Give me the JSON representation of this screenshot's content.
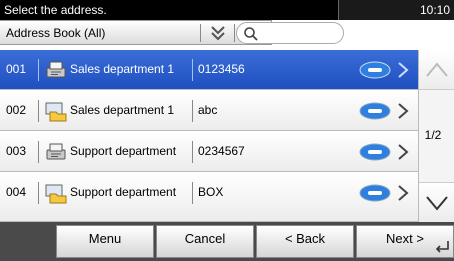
{
  "header": {
    "title": "Select the address.",
    "time": "10:10"
  },
  "source_select": {
    "value": "Address Book (All)"
  },
  "search": {
    "placeholder": ""
  },
  "rows": [
    {
      "number": "001",
      "type": "fax-icon",
      "name": "Sales department 1",
      "value": "0123456",
      "selected": true
    },
    {
      "number": "002",
      "type": "folder-icon",
      "name": "Sales department 1",
      "value": "abc",
      "selected": false
    },
    {
      "number": "003",
      "type": "fax-icon",
      "name": "Support department",
      "value": "0234567",
      "selected": false
    },
    {
      "number": "004",
      "type": "folder-icon",
      "name": "Support department",
      "value": "BOX",
      "selected": false
    }
  ],
  "pager": {
    "indicator": "1/2"
  },
  "footer": {
    "menu": "Menu",
    "cancel": "Cancel",
    "back": "< Back",
    "next": "Next >"
  },
  "colors": {
    "selected_row": "#2a5bd0",
    "detail_button": "#2f7fe0",
    "header_bg": "#000000"
  }
}
